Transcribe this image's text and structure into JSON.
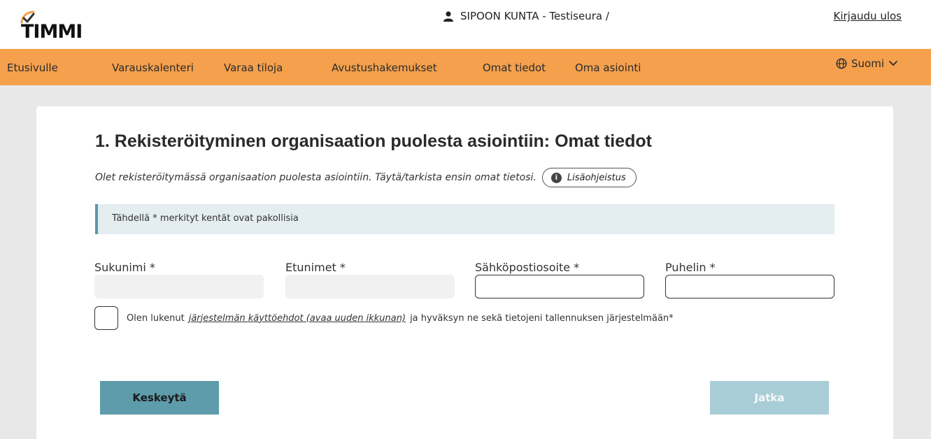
{
  "header": {
    "logo_text": "TIMMI",
    "user_label": "SIPOON KUNTA - Testiseura /",
    "logout_label": "Kirjaudu ulos"
  },
  "nav": {
    "items": [
      "Etusivulle",
      "Varauskalenteri",
      "Varaa tiloja",
      "Avustushakemukset",
      "Omat tiedot",
      "Oma asiointi"
    ],
    "language": "Suomi"
  },
  "form": {
    "title": "1. Rekisteröityminen organisaation puolesta asiointiin: Omat tiedot",
    "intro": "Olet rekisteröitymässä organisaation puolesta asiointiin. Täytä/tarkista ensin omat tietosi.",
    "help_label": "Lisäohjeistus",
    "notice": "Tähdellä * merkityt kentät ovat pakollisia",
    "fields": {
      "last_name": {
        "label": "Sukunimi *",
        "value": ""
      },
      "first_names": {
        "label": "Etunimet *",
        "value": ""
      },
      "email": {
        "label": "Sähköpostiosoite *",
        "value": ""
      },
      "phone": {
        "label": "Puhelin *",
        "value": ""
      }
    },
    "terms": {
      "prefix": "Olen lukenut",
      "link": "järjestelmän käyttöehdot (avaa uuden ikkunan)",
      "suffix": "ja hyväksyn ne sekä tietojeni tallennuksen järjestelmään*",
      "checked": false
    },
    "cancel_label": "Keskeytä",
    "continue_label": "Jatka"
  },
  "colors": {
    "nav_bg": "#f4a04d",
    "page_bg": "#e8e8e8",
    "notice_bg": "#e4edf0",
    "cancel_btn": "#5e9bab",
    "continue_btn_disabled": "#a9cdd6"
  }
}
